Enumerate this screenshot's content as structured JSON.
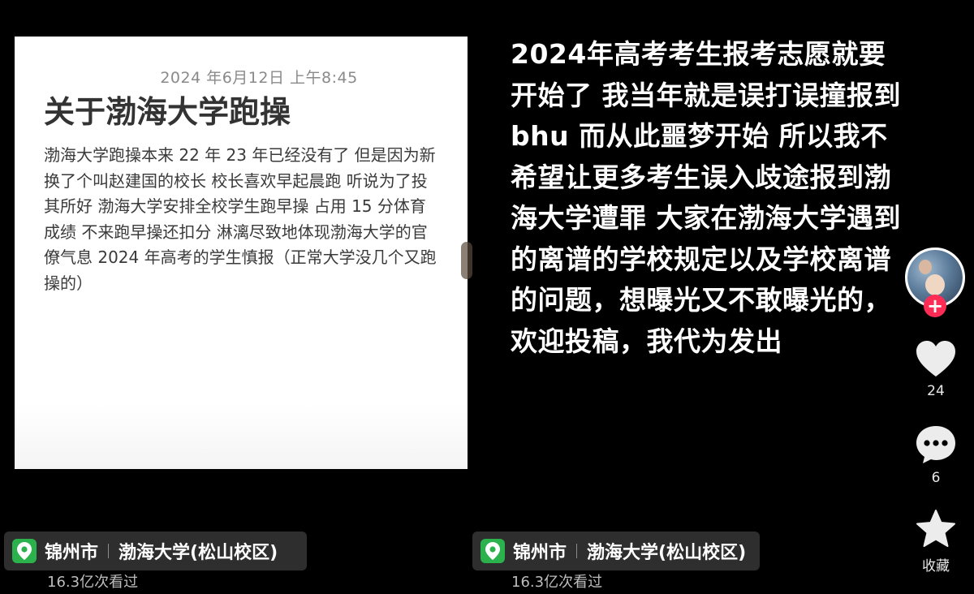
{
  "note": {
    "date": "2024 年6月12日 上午8:45",
    "title": "关于渤海大学跑操",
    "body": "渤海大学跑操本来 22 年 23 年已经没有了 但是因为新换了个叫赵建国的校长 校长喜欢早起晨跑 听说为了投其所好 渤海大学安排全校学生跑早操 占用 15 分体育成绩 不来跑早操还扣分 淋漓尽致地体现渤海大学的官僚气息 2024 年高考的学生慎报（正常大学没几个又跑操的）"
  },
  "caption": "2024年高考考生报考志愿就要开始了 我当年就是误打误撞报到bhu 而从此噩梦开始 所以我不希望让更多考生误入歧途报到渤海大学遭罪 大家在渤海大学遇到的离谱的学校规定以及学校离谱的问题，想曝光又不敢曝光的，欢迎投稿，我代为发出",
  "location_left": {
    "city": "锦州市",
    "place": "渤海大学(松山校区)",
    "views": "16.3亿次看过"
  },
  "location_right": {
    "city": "锦州市",
    "place": "渤海大学(松山校区)",
    "views": "16.3亿次看过"
  },
  "actions": {
    "like_count": "24",
    "comment_count": "6",
    "favorite_label": "收藏"
  },
  "icons": {
    "location": "location-pin-icon",
    "like": "heart-icon",
    "comment": "comment-bubble-icon",
    "favorite": "star-icon",
    "follow": "plus-icon"
  },
  "colors": {
    "location_green": "#2bb24c",
    "follow_red": "#fe2c55",
    "background": "#000000"
  }
}
